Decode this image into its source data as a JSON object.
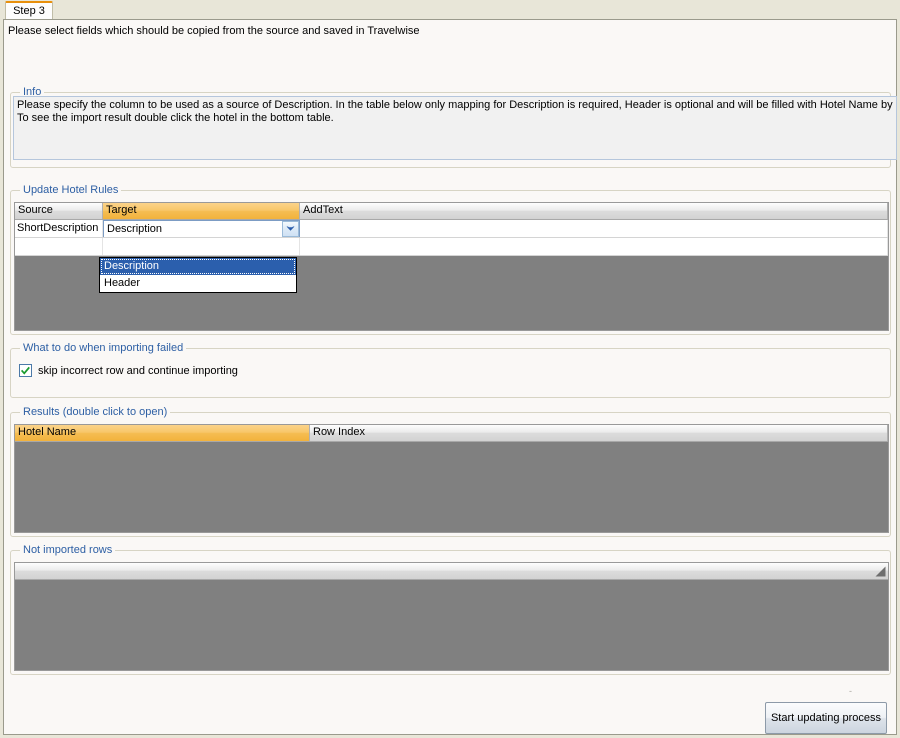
{
  "tab": {
    "label": "Step 3"
  },
  "page": {
    "description": "Please select fields which should be copied from the source and saved in Travelwise"
  },
  "info": {
    "title": "Info",
    "line1": "Please specify the column to be used as a source of Description. In the table below only mapping for Description is required, Header is optional and will be filled with Hotel Name by default",
    "line2": "To see the import result double click the hotel in the bottom table."
  },
  "rules": {
    "title": "Update Hotel Rules",
    "columns": [
      "Source",
      "Target",
      "AddText"
    ],
    "rows": [
      {
        "source": "ShortDescription",
        "target": "Description",
        "addtext": ""
      }
    ],
    "dropdown": {
      "open": true,
      "options": [
        "Description",
        "Header"
      ],
      "selected": "Description"
    }
  },
  "failure": {
    "title": "What to do when importing failed",
    "checkbox_label": "skip incorrect row and continue importing",
    "checkbox_checked": true
  },
  "results": {
    "title": "Results (double click to open)",
    "columns": [
      "Hotel Name",
      "Row Index"
    ],
    "rows": []
  },
  "not_imported": {
    "title": "Not imported rows",
    "columns": [
      ""
    ],
    "rows": []
  },
  "footer": {
    "start_button": "Start updating process",
    "tick": "-"
  },
  "colors": {
    "accent_tab": "#e8900c",
    "group_title": "#2d5fa4",
    "header_amber": "#f5bd52",
    "selection_blue": "#2b5fad",
    "grid_empty": "#808080",
    "window_bg": "#e8e6d8",
    "page_bg": "#faf8f6",
    "check_green": "#1a9b2e"
  }
}
